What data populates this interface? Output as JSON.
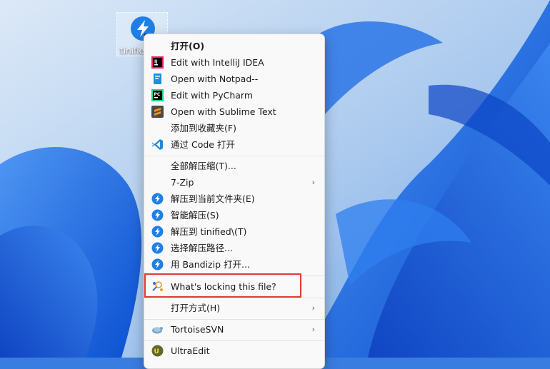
{
  "desktop": {
    "icon_label": "tinifie",
    "colors": {
      "wallpaper_base": "#3a7de0",
      "highlight": "#e53935"
    }
  },
  "menu": {
    "items": [
      {
        "label": "打开(O)",
        "icon": "",
        "bold": true
      },
      {
        "label": "Edit with IntelliJ IDEA",
        "icon": "intellij-icon"
      },
      {
        "label": "Open with Notpad--",
        "icon": "notepad-icon"
      },
      {
        "label": "Edit with PyCharm",
        "icon": "pycharm-icon"
      },
      {
        "label": "Open with Sublime Text",
        "icon": "sublime-icon"
      },
      {
        "label": "添加到收藏夹(F)",
        "icon": ""
      },
      {
        "label": "通过 Code 打开",
        "icon": "vscode-icon"
      },
      {
        "label": "全部解压缩(T)...",
        "icon": ""
      },
      {
        "label": "7-Zip",
        "icon": "",
        "submenu": true
      },
      {
        "label": "解压到当前文件夹(E)",
        "icon": "bandizip-icon"
      },
      {
        "label": "智能解压(S)",
        "icon": "bandizip-icon"
      },
      {
        "label": "解压到 tinified\\(T)",
        "icon": "bandizip-icon"
      },
      {
        "label": "选择解压路径...",
        "icon": "bandizip-icon"
      },
      {
        "label": "用 Bandizip 打开...",
        "icon": "bandizip-icon"
      },
      {
        "label": "What's locking this file?",
        "icon": "lock-search-icon"
      },
      {
        "label": "打开方式(H)",
        "icon": "",
        "submenu": true
      },
      {
        "label": "TortoiseSVN",
        "icon": "tortoise-icon",
        "submenu": true
      },
      {
        "label": "UltraEdit",
        "icon": "ultraedit-icon"
      }
    ],
    "submenu_arrow": "›"
  }
}
